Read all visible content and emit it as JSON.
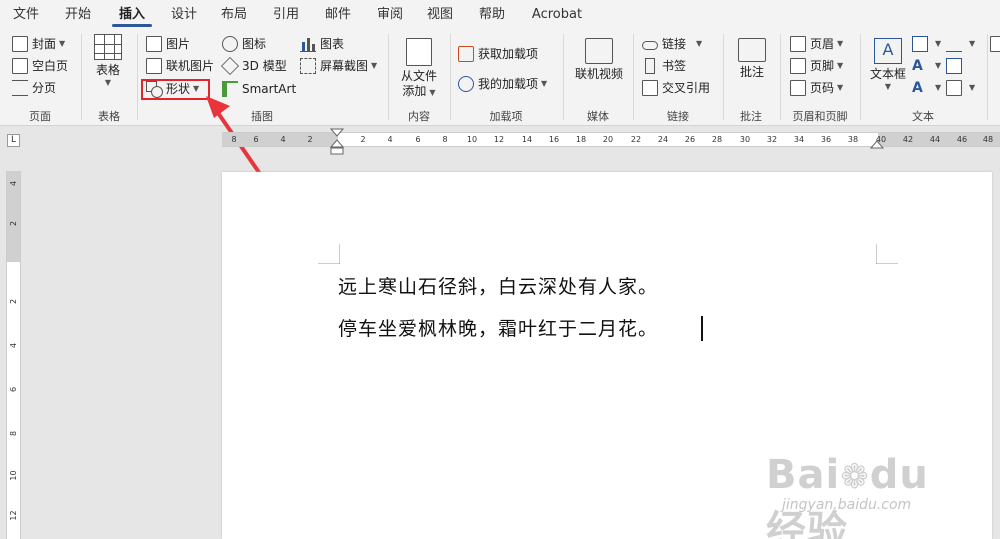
{
  "menu": {
    "tabs": [
      "文件",
      "开始",
      "插入",
      "设计",
      "布局",
      "引用",
      "邮件",
      "审阅",
      "视图",
      "帮助",
      "Acrobat"
    ],
    "active_tab": "插入"
  },
  "ribbon": {
    "pages": {
      "cover": "封面",
      "blank_page": "空白页",
      "page_break": "分页",
      "group_label": "页面"
    },
    "tables": {
      "table": "表格",
      "group_label": "表格"
    },
    "illustrations": {
      "pictures": "图片",
      "online_pictures": "联机图片",
      "shapes": "形状",
      "icons": "图标",
      "models_3d": "3D 模型",
      "smartart": "SmartArt",
      "chart": "图表",
      "screenshot": "屏幕截图",
      "group_label": "插图"
    },
    "content": {
      "from_file_line1": "从文件",
      "from_file_line2": "添加",
      "group_label": "内容"
    },
    "addins": {
      "get_addins": "获取加载项",
      "my_addins": "我的加载项",
      "group_label": "加载项"
    },
    "media": {
      "online_video": "联机视频",
      "group_label": "媒体"
    },
    "links": {
      "link": "链接",
      "bookmark": "书签",
      "cross_reference": "交叉引用",
      "group_label": "链接"
    },
    "comments": {
      "comment": "批注",
      "group_label": "批注"
    },
    "header_footer": {
      "header": "页眉",
      "footer": "页脚",
      "page_number": "页码",
      "group_label": "页眉和页脚"
    },
    "text": {
      "text_box": "文本框",
      "group_label": "文本"
    }
  },
  "ruler": {
    "corner": "L",
    "h_numbers": [
      "8",
      "6",
      "4",
      "2",
      "2",
      "4",
      "6",
      "8",
      "10",
      "12",
      "14",
      "16",
      "18",
      "20",
      "22",
      "24",
      "26",
      "28",
      "30",
      "32",
      "34",
      "36",
      "38",
      "40",
      "42",
      "44",
      "46",
      "48"
    ],
    "v_numbers": [
      "4",
      "2",
      "2",
      "4",
      "6",
      "8",
      "10",
      "12"
    ]
  },
  "document": {
    "line1": "远上寒山石径斜，白云深处有人家。",
    "line2": "停车坐爱枫林晚，霜叶红于二月花。"
  },
  "watermark": {
    "logo": "Bai du 经验",
    "url": "jingyan.baidu.com"
  },
  "colors": {
    "accent": "#2b579a",
    "highlight": "#e0262d",
    "arrow": "#e8353b"
  }
}
